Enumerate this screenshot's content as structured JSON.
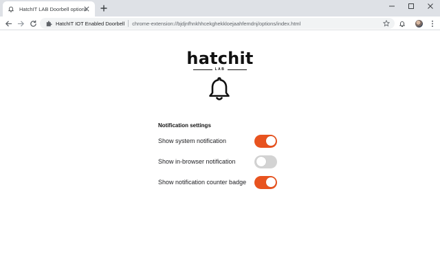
{
  "browser": {
    "tab": {
      "title": "HatchIT LAB Doorbell options",
      "icon": "bell-icon"
    },
    "window_controls": [
      "minimize",
      "maximize",
      "close"
    ],
    "address_bar": {
      "site_name": "HatchIT IOT Enabled Doorbell",
      "url": "chrome-extension://bjdjnfhnkhhcekghekkloejaahfemdnj/options/index.html"
    }
  },
  "page": {
    "logo": {
      "word": "hatchit",
      "sub": "LAB"
    },
    "section_heading": "Notification settings",
    "settings": [
      {
        "label": "Show system notification",
        "enabled": true
      },
      {
        "label": "Show in-browser notification",
        "enabled": false
      },
      {
        "label": "Show notification counter badge",
        "enabled": true
      }
    ]
  },
  "colors": {
    "toggle_on": "#e8531f",
    "toggle_off": "#d3d3d3",
    "tabstrip": "#dee1e6"
  }
}
